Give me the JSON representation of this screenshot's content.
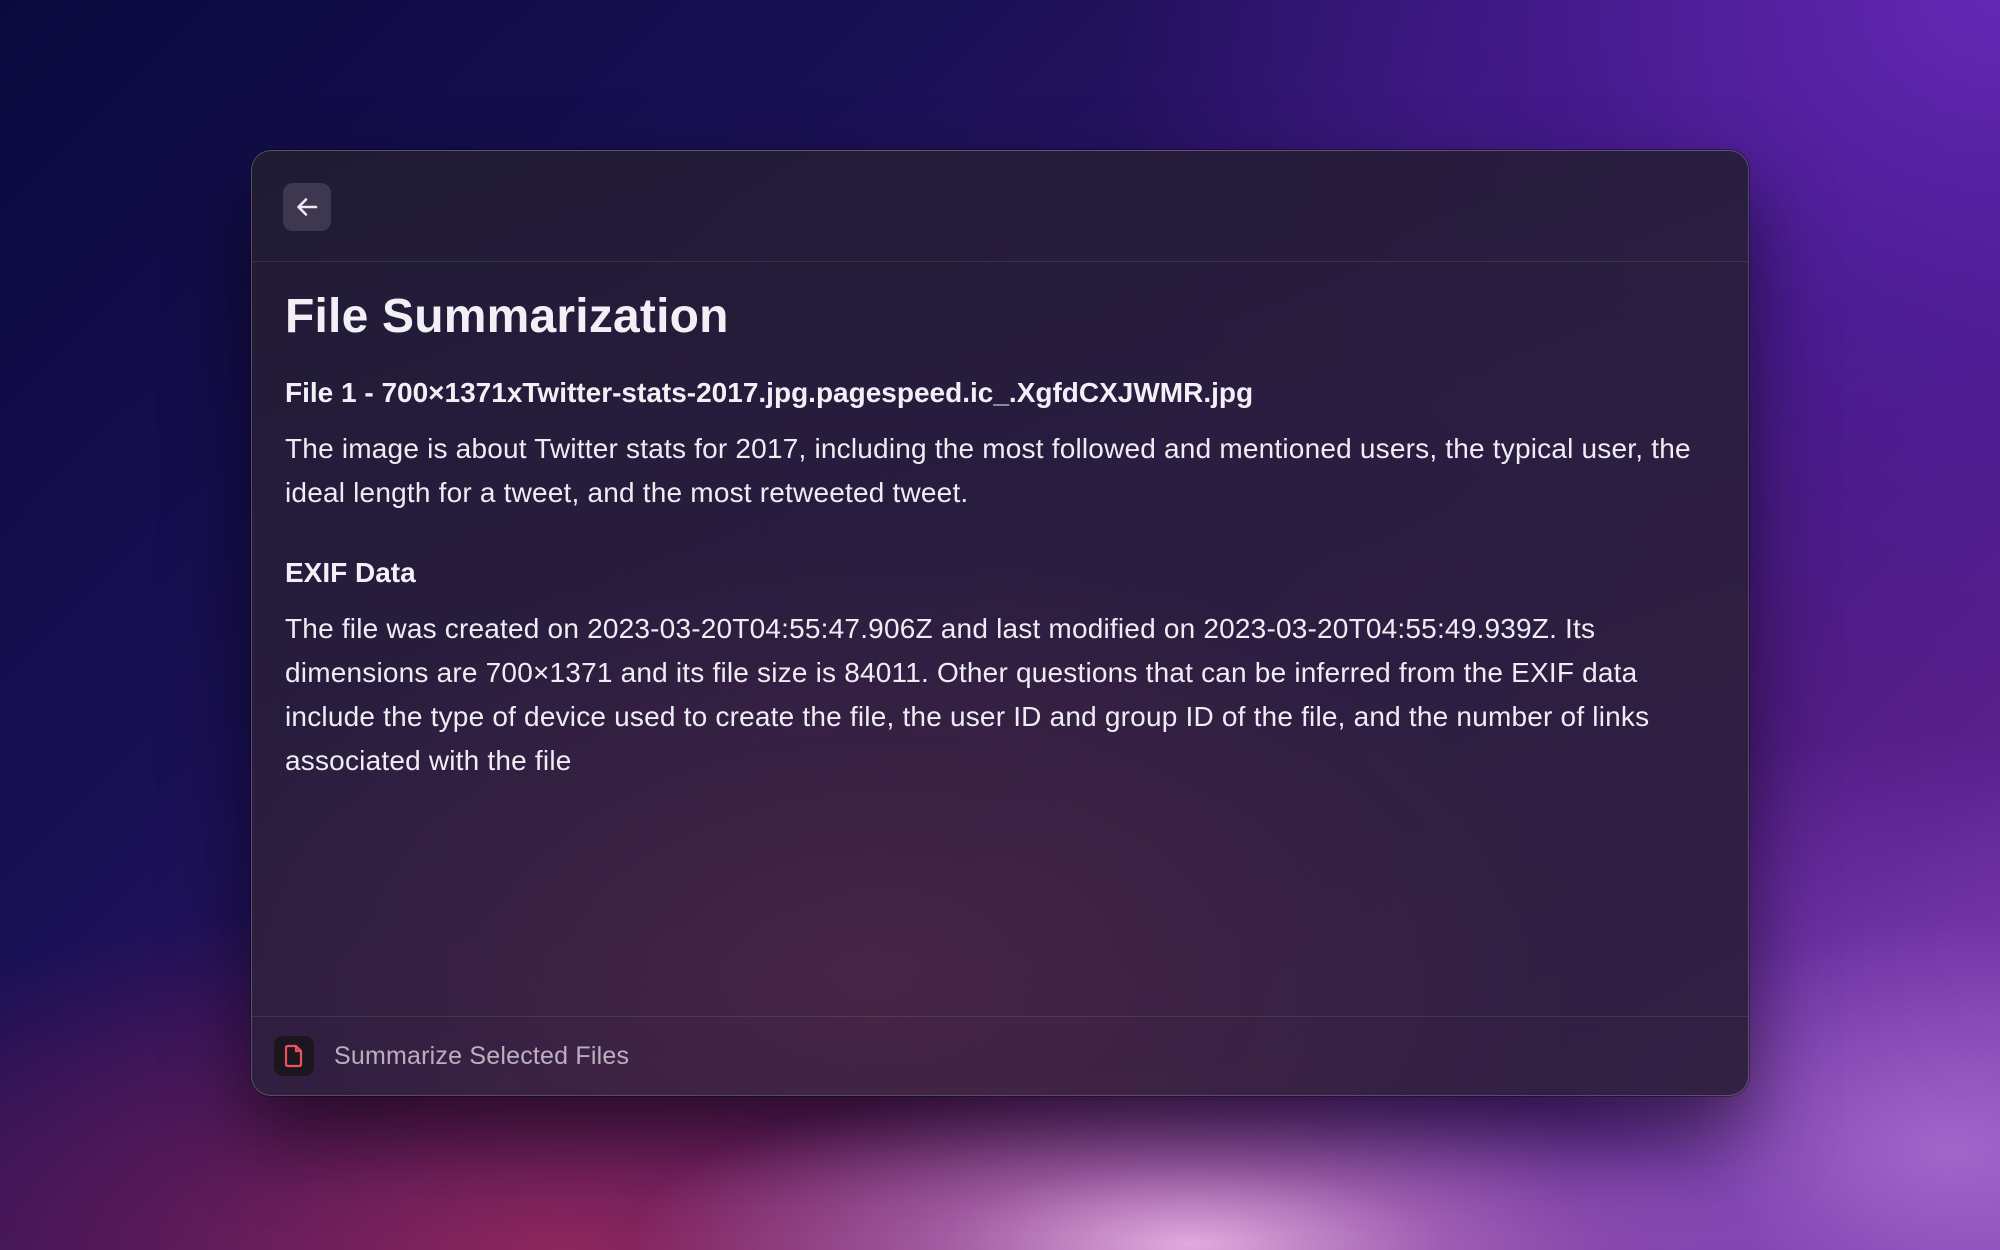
{
  "window": {
    "back_icon": "arrow-left-icon"
  },
  "content": {
    "title": "File Summarization",
    "file_heading": "File 1 - 700×1371xTwitter-stats-2017.jpg.pagespeed.ic_.XgfdCXJWMR.jpg",
    "file_summary": "The image is about Twitter stats for 2017, including the most followed and mentioned users, the typical user, the ideal length for a tweet, and the most retweeted tweet.",
    "exif_heading": "EXIF Data",
    "exif_summary": "The file was created on 2023-03-20T04:55:47.906Z and last modified on 2023-03-20T04:55:49.939Z. Its dimensions are 700×1371 and its file size is 84011. Other questions that can be inferred from the EXIF data include the type of device used to create the file, the user ID and group ID of the file, and the number of links associated with the file"
  },
  "footer": {
    "action_icon": "document-icon",
    "action_label": "Summarize Selected Files",
    "accent_color": "#f0525a"
  }
}
